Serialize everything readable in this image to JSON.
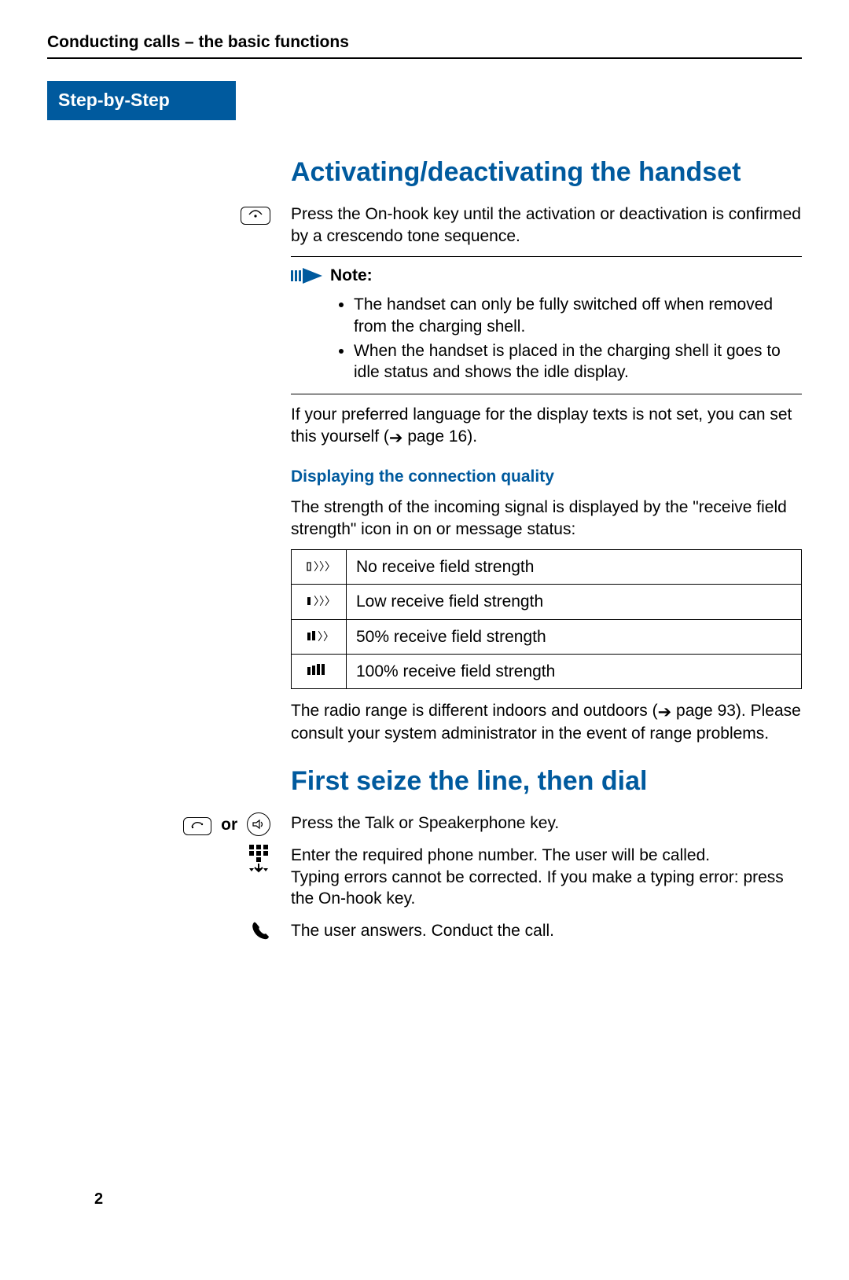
{
  "running_head": "Conducting calls – the basic functions",
  "step_by_step": "Step-by-Step",
  "section1": {
    "title": "Activating/deactivating the handset",
    "press_onhook": "Press the On-hook key until the activation or deactivation is confirmed by a crescendo tone sequence.",
    "note_label": "Note:",
    "note_items": [
      "The handset can only be fully switched off when removed from the charging shell.",
      "When the handset is placed in the charging shell it goes to idle status and shows the idle display."
    ],
    "lang_text_pre": "If your preferred language for the display texts is not set, you can set this yourself (",
    "lang_text_post": " page 16).",
    "sub_title": "Displaying the connection quality",
    "signal_intro": "The strength of the incoming signal is displayed by the \"receive field strength\" icon in on or message status:",
    "signal_rows": [
      {
        "icon": "signal-0",
        "desc": "No receive field strength"
      },
      {
        "icon": "signal-1",
        "desc": "Low receive field strength"
      },
      {
        "icon": "signal-2",
        "desc": "50% receive field strength"
      },
      {
        "icon": "signal-3",
        "desc": "100% receive field strength"
      }
    ],
    "range_text_pre": "The radio range is different indoors and outdoors (",
    "range_text_post": " page 93). Please consult your system administrator in the event of range problems."
  },
  "section2": {
    "title": "First seize the line, then dial",
    "or_label": "or",
    "press_talk": "Press the Talk or Speakerphone key.",
    "enter_number": "Enter the required phone number. The user will be called.",
    "typing_errors": "Typing errors cannot be corrected. If you make a typing error: press the On-hook key.",
    "user_answers": "The user answers. Conduct the call."
  },
  "page_number": "2"
}
